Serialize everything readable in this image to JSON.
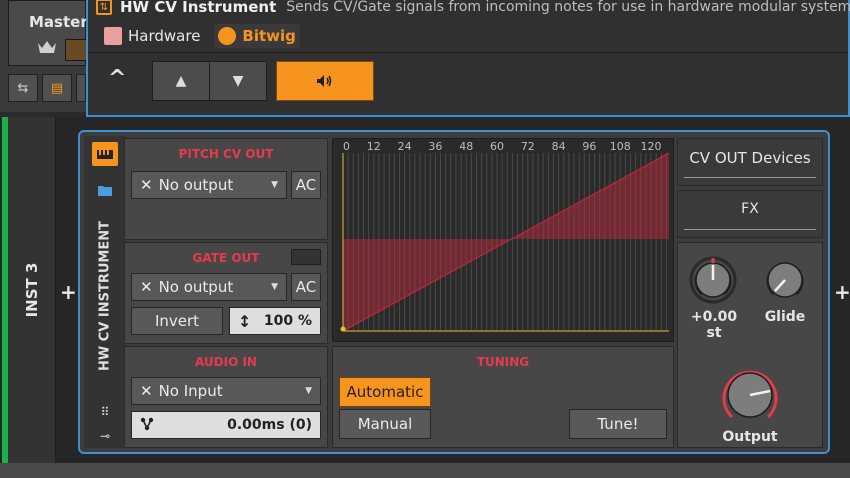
{
  "master": {
    "label": "Master"
  },
  "header": {
    "device_name": "HW CV Instrument",
    "description": "Sends CV/Gate signals from incoming notes for use in hardware modular systems",
    "tags": [
      {
        "label": "Hardware",
        "active": false
      },
      {
        "label": "Bitwig",
        "active": true
      }
    ]
  },
  "track": {
    "name": "INST 3"
  },
  "device": {
    "side_title": "HW CV INSTRUMENT",
    "pitch_cv_out": {
      "title": "PITCH CV OUT",
      "output": "No output",
      "ac_label": "AC"
    },
    "gate_out": {
      "title": "GATE OUT",
      "output": "No output",
      "ac_label": "AC",
      "invert_label": "Invert",
      "amount": "100 %"
    },
    "audio_in": {
      "title": "AUDIO IN",
      "input": "No Input",
      "latency": "0.00ms (0)"
    },
    "graph": {
      "ticks": [
        "0",
        "12",
        "24",
        "36",
        "48",
        "60",
        "72",
        "84",
        "96",
        "108",
        "120"
      ]
    },
    "tuning": {
      "title": "TUNING",
      "modes": [
        "Automatic",
        "Manual"
      ],
      "active_mode": "Automatic",
      "tune_label": "Tune!"
    },
    "right": {
      "cv_out_devices": "CV OUT Devices",
      "fx": "FX",
      "pitch_value": "+0.00 st",
      "glide_label": "Glide",
      "output_label": "Output"
    }
  },
  "colors": {
    "accent": "#f7941d",
    "selection": "#3d8fd1",
    "section_title": "#e83a4f",
    "track": "#19b34a"
  }
}
